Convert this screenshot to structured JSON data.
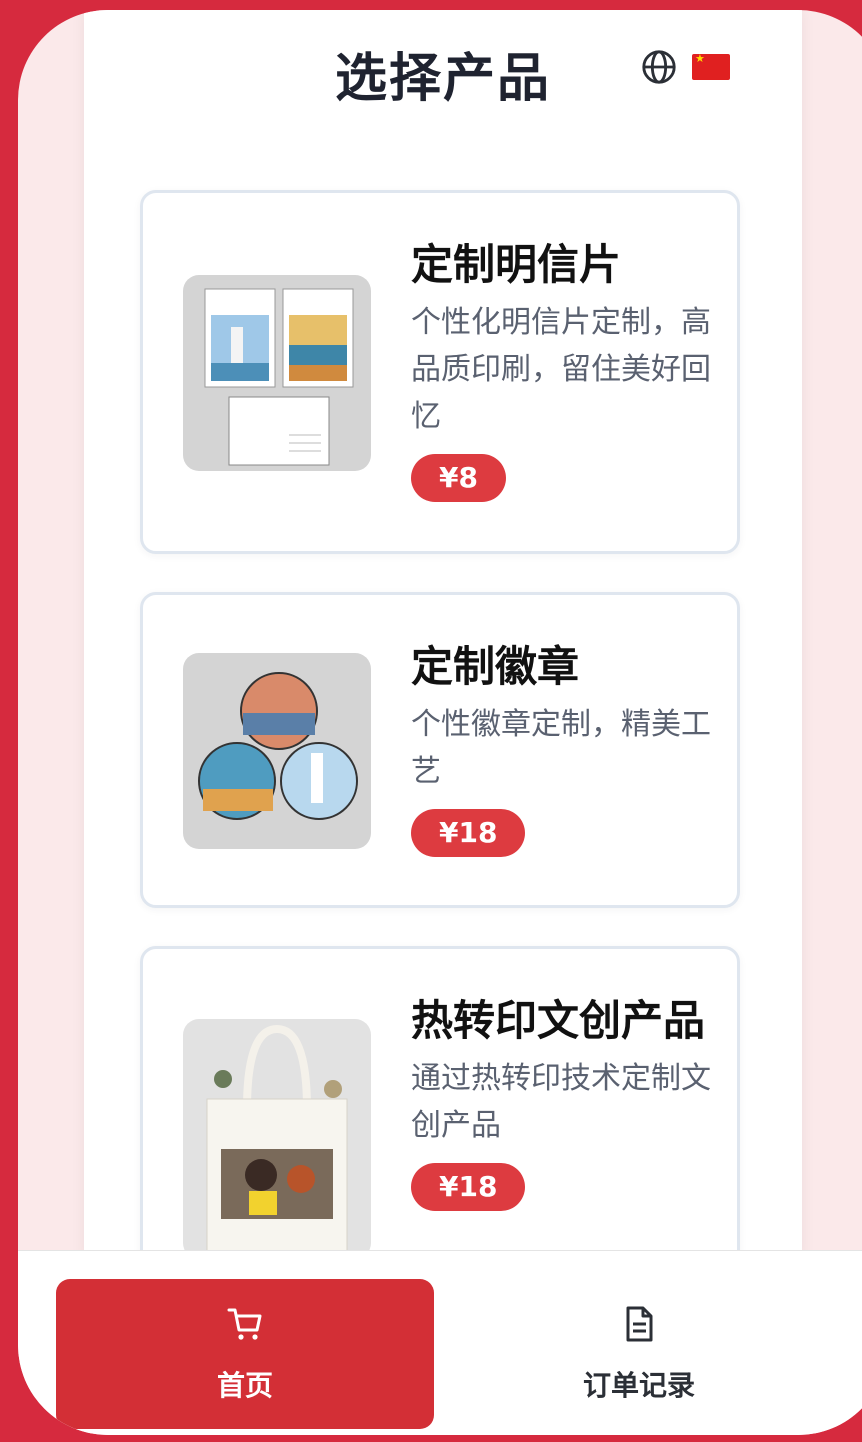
{
  "header": {
    "title": "选择产品",
    "globe_icon": "globe-icon",
    "flag_icon": "china-flag-icon"
  },
  "products": [
    {
      "name": "定制明信片",
      "description": "个性化明信片定制，高品质印刷，留住美好回忆",
      "price": "¥8"
    },
    {
      "name": "定制徽章",
      "description": "个性徽章定制，精美工艺",
      "price": "¥18"
    },
    {
      "name": "热转印文创产品",
      "description": "通过热转印技术定制文创产品",
      "price": "¥18"
    }
  ],
  "tabbar": {
    "home": {
      "label": "首页",
      "icon": "cart-icon"
    },
    "orders": {
      "label": "订单记录",
      "icon": "document-icon"
    }
  },
  "colors": {
    "brand_red": "#d32f36",
    "price_red": "#dd3b40",
    "frame_red": "#d62a3e"
  }
}
